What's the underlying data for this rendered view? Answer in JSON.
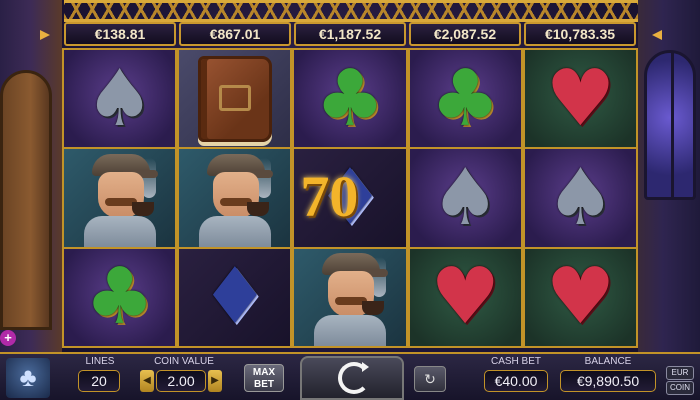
{
  "jackpots": [
    "€138.81",
    "€867.01",
    "€1,187.52",
    "€2,087.52",
    "€10,783.35"
  ],
  "reels": [
    [
      "spade",
      "detective",
      "club"
    ],
    [
      "book",
      "detective",
      "diamond"
    ],
    [
      "club",
      "diamond",
      "detective"
    ],
    [
      "club",
      "spade",
      "heart"
    ],
    [
      "heart",
      "spade",
      "heart"
    ]
  ],
  "win_amount": "70",
  "controls": {
    "lines_label": "LINES",
    "lines_value": "20",
    "coin_value_label": "COIN VALUE",
    "coin_value": "2.00",
    "max_bet_label": "MAX BET",
    "cash_bet_label": "CASH BET",
    "cash_bet_value": "€40.00",
    "balance_label": "BALANCE",
    "balance_value": "€9,890.50",
    "currency_label": "EUR",
    "coin_label": "COIN"
  },
  "icons": {
    "spin": "refresh-arrow-icon",
    "autoplay": "autoplay-icon",
    "logo": "tree-logo-icon",
    "menu": "plus-icon",
    "suit_glyphs": {
      "spade": "♠",
      "club": "♣",
      "heart": "♥",
      "diamond": "♦"
    }
  },
  "colors": {
    "frame_gold": "#c29328",
    "win_gold": "#f3b42a"
  }
}
